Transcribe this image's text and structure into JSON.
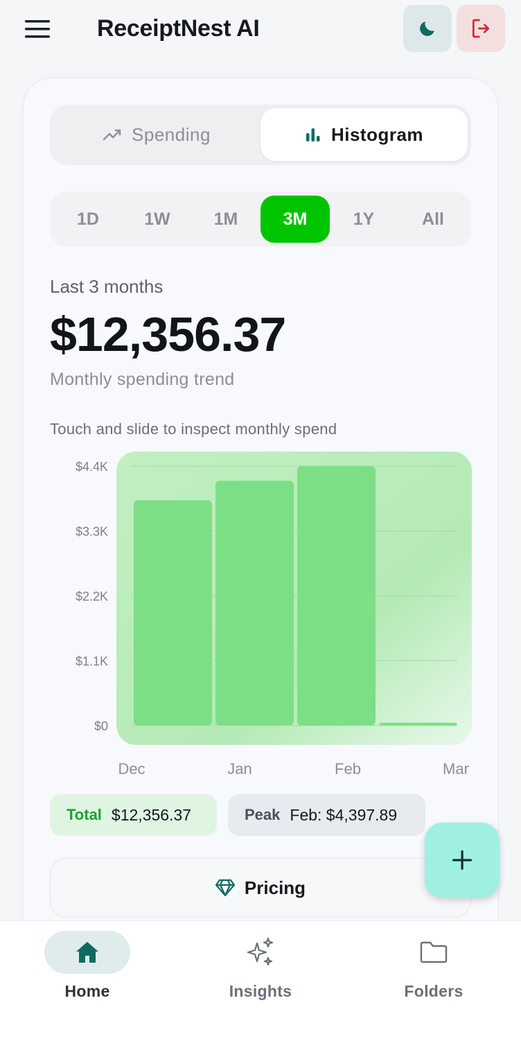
{
  "header": {
    "title": "ReceiptNest AI",
    "menu_icon": "menu-icon",
    "theme_icon": "moon-icon",
    "logout_icon": "logout-icon"
  },
  "view_toggle": {
    "options": [
      {
        "label": "Spending",
        "icon": "trend-line-icon",
        "selected": false
      },
      {
        "label": "Histogram",
        "icon": "bar-chart-icon",
        "selected": true
      }
    ]
  },
  "ranges": [
    {
      "label": "1D",
      "selected": false
    },
    {
      "label": "1W",
      "selected": false
    },
    {
      "label": "1M",
      "selected": false
    },
    {
      "label": "3M",
      "selected": true
    },
    {
      "label": "1Y",
      "selected": false
    },
    {
      "label": "All",
      "selected": false
    }
  ],
  "summary": {
    "period_label": "Last 3 months",
    "total_amount": "$12,356.37",
    "subtitle": "Monthly spending trend",
    "hint": "Touch and slide to inspect monthly spend"
  },
  "chart_data": {
    "type": "bar",
    "categories": [
      "Dec",
      "Jan",
      "Feb",
      "Mar"
    ],
    "values": [
      3820,
      4150,
      4397.89,
      0
    ],
    "yticks": [
      "$0",
      "$1.1K",
      "$2.2K",
      "$3.3K",
      "$4.4K"
    ],
    "ylim": [
      0,
      4400
    ],
    "grid": true,
    "bar_color": "#7ddf85",
    "title": "",
    "xlabel": "",
    "ylabel": ""
  },
  "stats": {
    "total_label": "Total",
    "total_value": "$12,356.37",
    "peak_label": "Peak",
    "peak_value": "Feb: $4,397.89"
  },
  "pricing": {
    "label": "Pricing",
    "icon": "diamond-icon"
  },
  "fab": {
    "icon": "plus-icon"
  },
  "bottom_nav": {
    "items": [
      {
        "label": "Home",
        "icon": "home-icon",
        "active": true
      },
      {
        "label": "Insights",
        "icon": "sparkles-icon",
        "active": false
      },
      {
        "label": "Folders",
        "icon": "folder-icon",
        "active": false
      }
    ]
  },
  "colors": {
    "accent_green": "#00c400",
    "teal": "#0e6b60",
    "logout_red": "#d9252f",
    "fab_bg": "#9ff0e3"
  }
}
